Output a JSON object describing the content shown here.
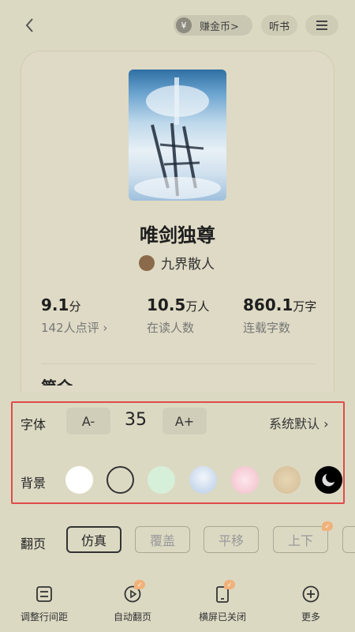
{
  "topbar": {
    "coin_symbol": "¥",
    "coin_label": "赚金币>",
    "listen_label": "听书"
  },
  "book": {
    "title": "唯剑独尊",
    "author": "九界散人"
  },
  "stats": [
    {
      "value": "9.1",
      "unit": "分",
      "sub": "142人点评 ›"
    },
    {
      "value": "10.5",
      "unit": "万人",
      "sub": "在读人数"
    },
    {
      "value": "860.1",
      "unit": "万字",
      "sub": "连载字数"
    }
  ],
  "intro_peek": "简介",
  "settings": {
    "font_label": "字体",
    "font_decrease": "A-",
    "font_size": "35",
    "font_increase": "A+",
    "font_default": "系统默认 ›",
    "background_label": "背景",
    "backgrounds": [
      {
        "name": "white",
        "color": "#ffffff"
      },
      {
        "name": "beige-selected",
        "color": "#dcd9c3"
      },
      {
        "name": "light-green",
        "color": "#d6efd9"
      },
      {
        "name": "light-blue-pattern",
        "color": "#c8d8ec"
      },
      {
        "name": "pink-pattern",
        "color": "#f6c9d3"
      },
      {
        "name": "tan-pattern",
        "color": "#d9c49e"
      },
      {
        "name": "night-mode",
        "color": "#000000"
      }
    ],
    "page_turn_label": "翻页",
    "page_turn_options": [
      "仿真",
      "覆盖",
      "平移",
      "上下"
    ],
    "page_turn_selected": "仿真"
  },
  "toolbar": {
    "items": [
      {
        "label": "调整行间距",
        "icon": "line-spacing-icon"
      },
      {
        "label": "自动翻页",
        "icon": "auto-page-icon"
      },
      {
        "label": "横屏已关闭",
        "icon": "landscape-icon"
      },
      {
        "label": "更多",
        "icon": "more-plus-icon"
      }
    ]
  },
  "colors": {
    "background": "#dcd9c3",
    "highlight": "#e04a4a",
    "badge": "#f0b27a"
  }
}
